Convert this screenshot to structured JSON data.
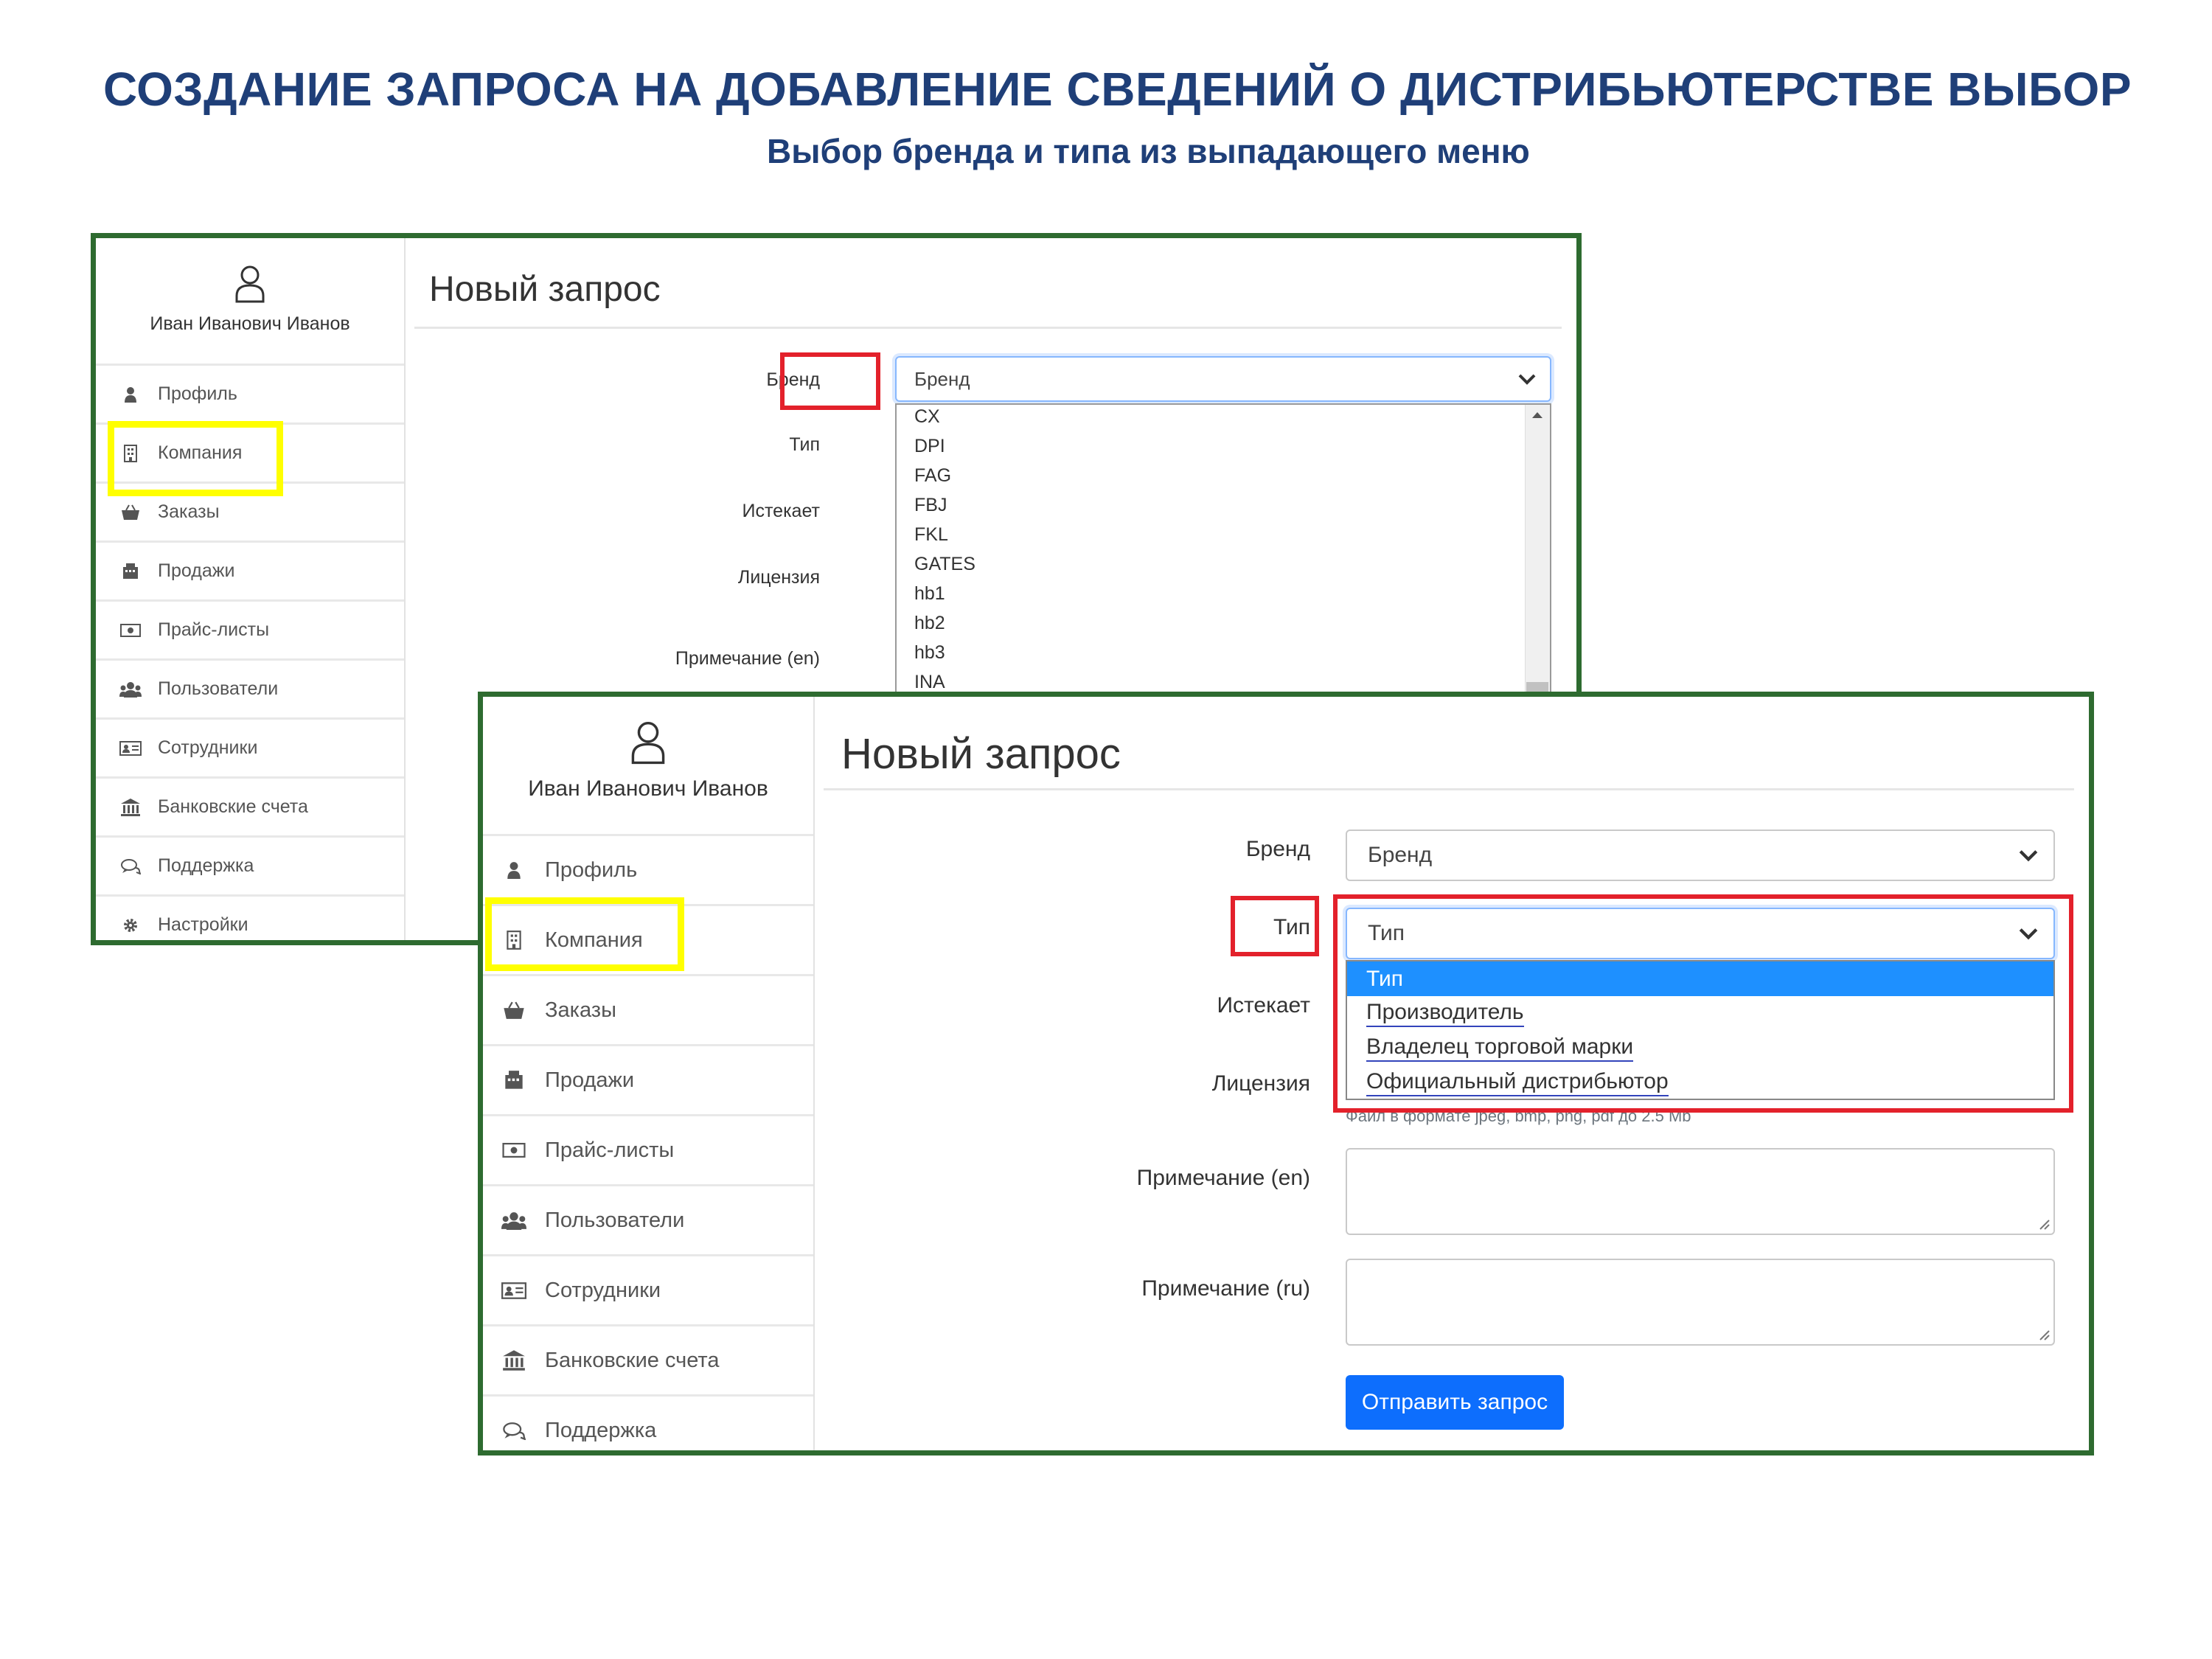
{
  "slide": {
    "title": "СОЗДАНИЕ ЗАПРОСА  НА ДОБАВЛЕНИЕ СВЕДЕНИЙ О ДИСТРИБЬЮТЕРСТВЕ ВЫБОР",
    "subtitle": "Выбор бренда и типа из выпадающего меню"
  },
  "colors": {
    "panel_border": "#2e6b30",
    "yellow_highlight": "#ffff00",
    "red_highlight": "#e3212b",
    "primary": "#0d6efd",
    "selected_option": "#1e90ff",
    "title": "#1f3f78"
  },
  "user": {
    "name": "Иван Иванович Иванов",
    "icon": "user-outline-icon"
  },
  "sidebar": {
    "items": [
      {
        "label": "Профиль",
        "icon": "user-icon"
      },
      {
        "label": "Компания",
        "icon": "building-icon"
      },
      {
        "label": "Заказы",
        "icon": "basket-icon"
      },
      {
        "label": "Продажи",
        "icon": "register-icon"
      },
      {
        "label": "Прайс-листы",
        "icon": "money-icon"
      },
      {
        "label": "Пользователи",
        "icon": "users-icon"
      },
      {
        "label": "Сотрудники",
        "icon": "id-card-icon"
      },
      {
        "label": "Банковские счета",
        "icon": "bank-icon"
      },
      {
        "label": "Поддержка",
        "icon": "chat-icon"
      },
      {
        "label": "Настройки",
        "icon": "gear-icon"
      }
    ]
  },
  "form": {
    "page_title": "Новый запрос",
    "labels": {
      "brand": "Бренд",
      "type": "Тип",
      "expires": "Истекает",
      "license": "Лицензия",
      "note_en": "Примечание (en)",
      "note_ru": "Примечание (ru)"
    },
    "brand_value": "Бренд",
    "type_value": "Тип",
    "brand_options": [
      "CX",
      "DPI",
      "FAG",
      "FBJ",
      "FKL",
      "GATES",
      "hb1",
      "hb2",
      "hb3",
      "INA"
    ],
    "type_options": [
      "Тип",
      "Производитель",
      "Владелец торговой марки",
      "Официальный дистрибьютор"
    ],
    "license_help": "Файл в формате jpeg, bmp, png, pdf до 2.5 Mb",
    "submit_label": "Отправить запрос"
  }
}
